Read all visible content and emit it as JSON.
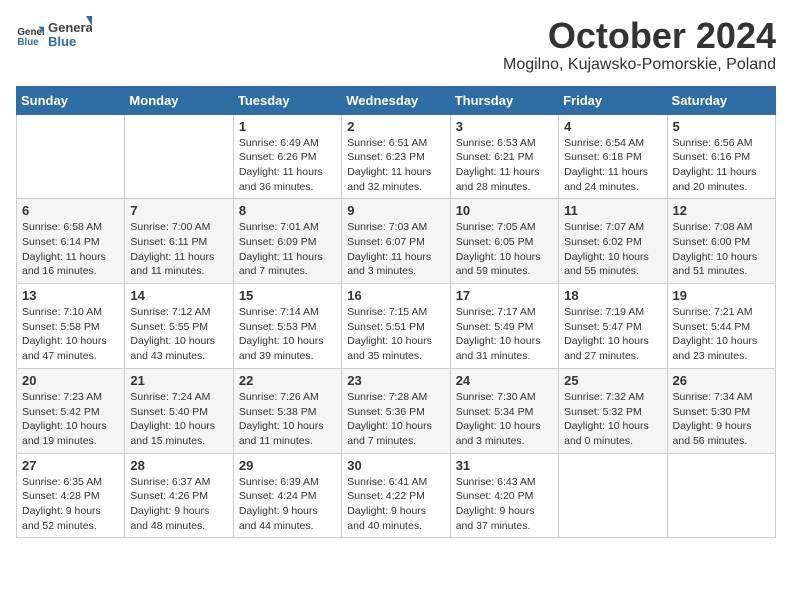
{
  "logo": {
    "general": "General",
    "blue": "Blue"
  },
  "title": "October 2024",
  "location": "Mogilno, Kujawsko-Pomorskie, Poland",
  "days_header": [
    "Sunday",
    "Monday",
    "Tuesday",
    "Wednesday",
    "Thursday",
    "Friday",
    "Saturday"
  ],
  "weeks": [
    [
      {
        "day": "",
        "detail": ""
      },
      {
        "day": "",
        "detail": ""
      },
      {
        "day": "1",
        "detail": "Sunrise: 6:49 AM\nSunset: 6:26 PM\nDaylight: 11 hours\nand 36 minutes."
      },
      {
        "day": "2",
        "detail": "Sunrise: 6:51 AM\nSunset: 6:23 PM\nDaylight: 11 hours\nand 32 minutes."
      },
      {
        "day": "3",
        "detail": "Sunrise: 6:53 AM\nSunset: 6:21 PM\nDaylight: 11 hours\nand 28 minutes."
      },
      {
        "day": "4",
        "detail": "Sunrise: 6:54 AM\nSunset: 6:18 PM\nDaylight: 11 hours\nand 24 minutes."
      },
      {
        "day": "5",
        "detail": "Sunrise: 6:56 AM\nSunset: 6:16 PM\nDaylight: 11 hours\nand 20 minutes."
      }
    ],
    [
      {
        "day": "6",
        "detail": "Sunrise: 6:58 AM\nSunset: 6:14 PM\nDaylight: 11 hours\nand 16 minutes."
      },
      {
        "day": "7",
        "detail": "Sunrise: 7:00 AM\nSunset: 6:11 PM\nDaylight: 11 hours\nand 11 minutes."
      },
      {
        "day": "8",
        "detail": "Sunrise: 7:01 AM\nSunset: 6:09 PM\nDaylight: 11 hours\nand 7 minutes."
      },
      {
        "day": "9",
        "detail": "Sunrise: 7:03 AM\nSunset: 6:07 PM\nDaylight: 11 hours\nand 3 minutes."
      },
      {
        "day": "10",
        "detail": "Sunrise: 7:05 AM\nSunset: 6:05 PM\nDaylight: 10 hours\nand 59 minutes."
      },
      {
        "day": "11",
        "detail": "Sunrise: 7:07 AM\nSunset: 6:02 PM\nDaylight: 10 hours\nand 55 minutes."
      },
      {
        "day": "12",
        "detail": "Sunrise: 7:08 AM\nSunset: 6:00 PM\nDaylight: 10 hours\nand 51 minutes."
      }
    ],
    [
      {
        "day": "13",
        "detail": "Sunrise: 7:10 AM\nSunset: 5:58 PM\nDaylight: 10 hours\nand 47 minutes."
      },
      {
        "day": "14",
        "detail": "Sunrise: 7:12 AM\nSunset: 5:55 PM\nDaylight: 10 hours\nand 43 minutes."
      },
      {
        "day": "15",
        "detail": "Sunrise: 7:14 AM\nSunset: 5:53 PM\nDaylight: 10 hours\nand 39 minutes."
      },
      {
        "day": "16",
        "detail": "Sunrise: 7:15 AM\nSunset: 5:51 PM\nDaylight: 10 hours\nand 35 minutes."
      },
      {
        "day": "17",
        "detail": "Sunrise: 7:17 AM\nSunset: 5:49 PM\nDaylight: 10 hours\nand 31 minutes."
      },
      {
        "day": "18",
        "detail": "Sunrise: 7:19 AM\nSunset: 5:47 PM\nDaylight: 10 hours\nand 27 minutes."
      },
      {
        "day": "19",
        "detail": "Sunrise: 7:21 AM\nSunset: 5:44 PM\nDaylight: 10 hours\nand 23 minutes."
      }
    ],
    [
      {
        "day": "20",
        "detail": "Sunrise: 7:23 AM\nSunset: 5:42 PM\nDaylight: 10 hours\nand 19 minutes."
      },
      {
        "day": "21",
        "detail": "Sunrise: 7:24 AM\nSunset: 5:40 PM\nDaylight: 10 hours\nand 15 minutes."
      },
      {
        "day": "22",
        "detail": "Sunrise: 7:26 AM\nSunset: 5:38 PM\nDaylight: 10 hours\nand 11 minutes."
      },
      {
        "day": "23",
        "detail": "Sunrise: 7:28 AM\nSunset: 5:36 PM\nDaylight: 10 hours\nand 7 minutes."
      },
      {
        "day": "24",
        "detail": "Sunrise: 7:30 AM\nSunset: 5:34 PM\nDaylight: 10 hours\nand 3 minutes."
      },
      {
        "day": "25",
        "detail": "Sunrise: 7:32 AM\nSunset: 5:32 PM\nDaylight: 10 hours\nand 0 minutes."
      },
      {
        "day": "26",
        "detail": "Sunrise: 7:34 AM\nSunset: 5:30 PM\nDaylight: 9 hours\nand 56 minutes."
      }
    ],
    [
      {
        "day": "27",
        "detail": "Sunrise: 6:35 AM\nSunset: 4:28 PM\nDaylight: 9 hours\nand 52 minutes."
      },
      {
        "day": "28",
        "detail": "Sunrise: 6:37 AM\nSunset: 4:26 PM\nDaylight: 9 hours\nand 48 minutes."
      },
      {
        "day": "29",
        "detail": "Sunrise: 6:39 AM\nSunset: 4:24 PM\nDaylight: 9 hours\nand 44 minutes."
      },
      {
        "day": "30",
        "detail": "Sunrise: 6:41 AM\nSunset: 4:22 PM\nDaylight: 9 hours\nand 40 minutes."
      },
      {
        "day": "31",
        "detail": "Sunrise: 6:43 AM\nSunset: 4:20 PM\nDaylight: 9 hours\nand 37 minutes."
      },
      {
        "day": "",
        "detail": ""
      },
      {
        "day": "",
        "detail": ""
      }
    ]
  ]
}
